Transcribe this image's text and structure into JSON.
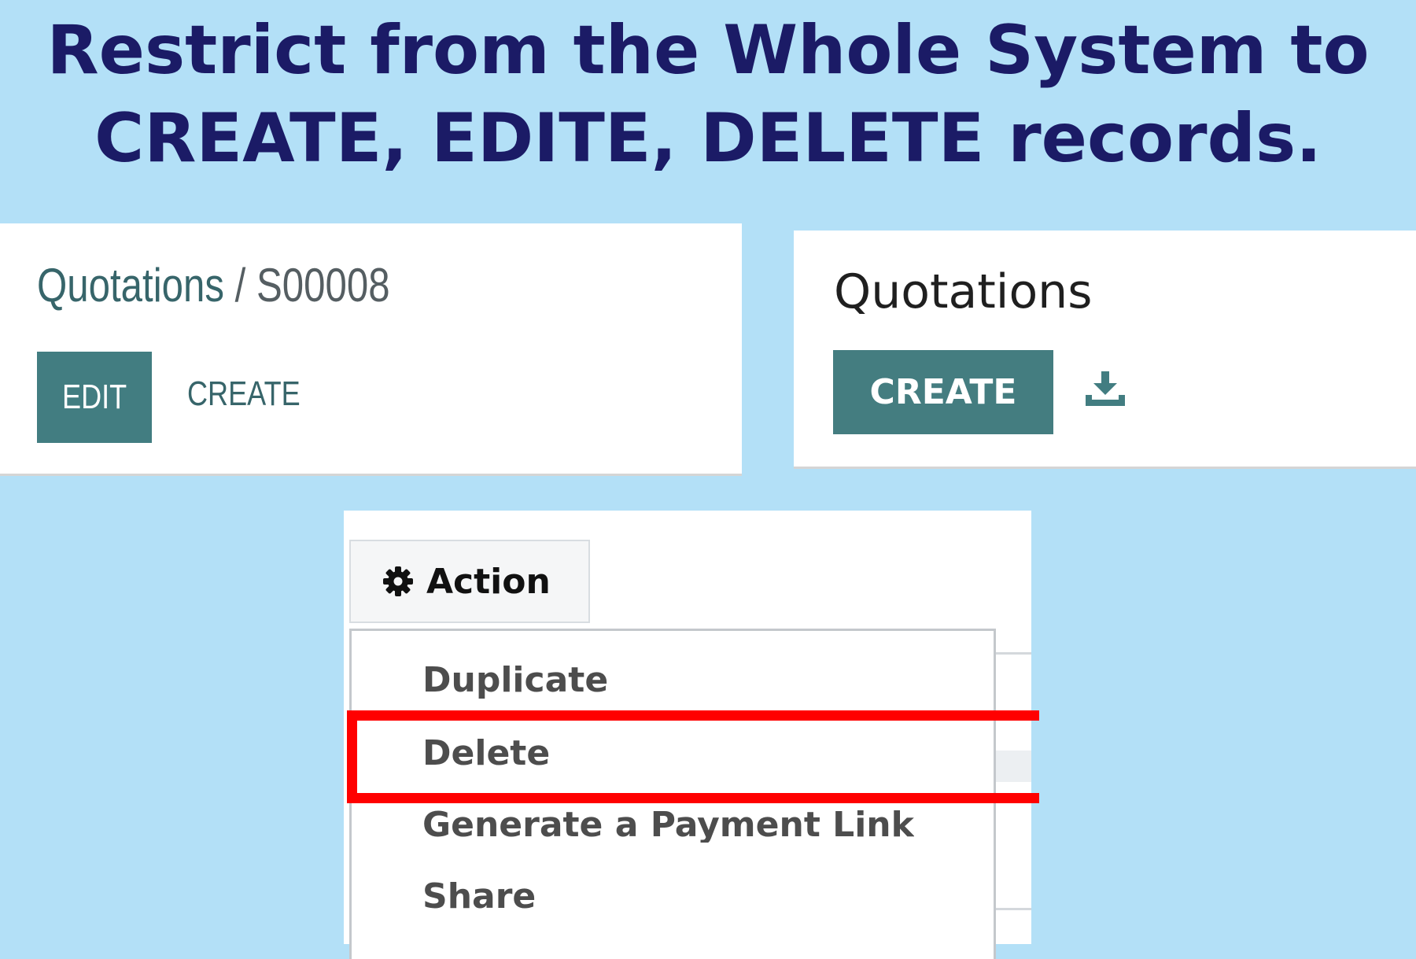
{
  "headline": {
    "line1": "Restrict from the Whole System to",
    "line2": "CREATE, EDITE, DELETE records."
  },
  "form_view": {
    "breadcrumb_root": "Quotations",
    "breadcrumb_separator": "/",
    "breadcrumb_record": "S00008",
    "edit_label": "EDIT",
    "create_label": "CREATE"
  },
  "list_view": {
    "title": "Quotations",
    "create_label": "CREATE",
    "download_icon": "download-icon"
  },
  "action_menu": {
    "button_icon": "gear-icon",
    "button_label": "Action",
    "items": [
      {
        "label": "Duplicate"
      },
      {
        "label": "Delete"
      },
      {
        "label": "Generate a Payment Link"
      },
      {
        "label": "Share"
      }
    ],
    "highlighted_item": "Delete"
  },
  "colors": {
    "background": "#b3e0f7",
    "headline": "#1b1b66",
    "primary_button": "#427d81",
    "highlight": "#ff0000"
  }
}
